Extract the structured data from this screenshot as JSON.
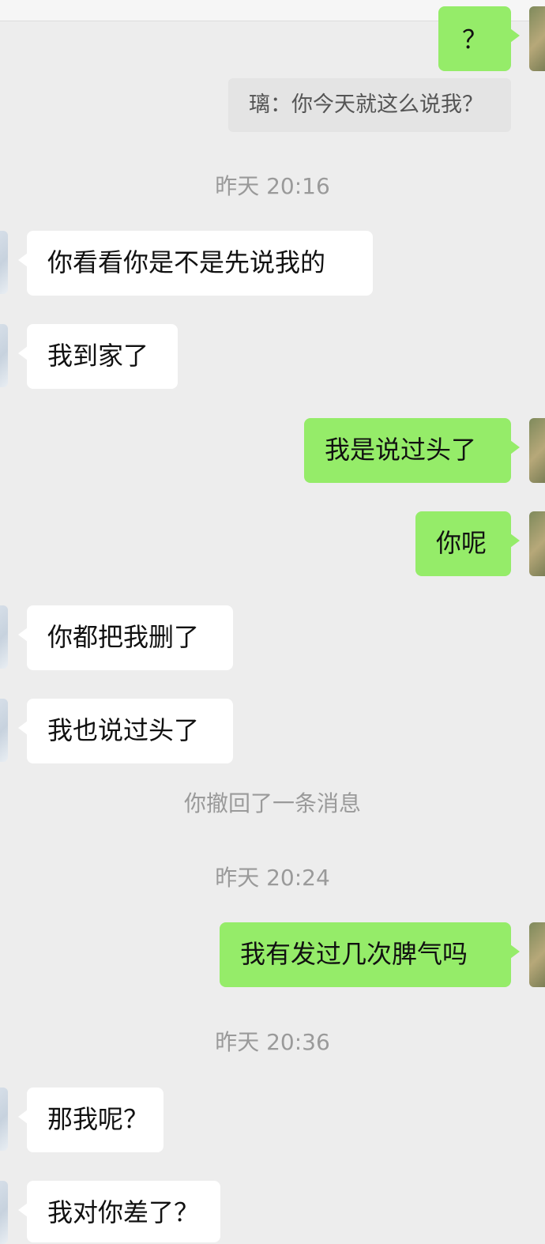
{
  "chat": {
    "messages": [
      {
        "side": "out",
        "text": "？"
      },
      {
        "side": "quote",
        "text": "璃：你今天就这么说我？"
      },
      {
        "type": "time",
        "text": "昨天 20:16"
      },
      {
        "side": "in",
        "text": "你看看你是不是先说我的"
      },
      {
        "side": "in",
        "text": "我到家了"
      },
      {
        "side": "out",
        "text": "我是说过头了"
      },
      {
        "side": "out",
        "text": "你呢"
      },
      {
        "side": "in",
        "text": "你都把我删了"
      },
      {
        "side": "in",
        "text": "我也说过头了"
      },
      {
        "type": "system",
        "text": "你撤回了一条消息"
      },
      {
        "type": "time",
        "text": "昨天 20:24"
      },
      {
        "side": "out",
        "text": "我有发过几次脾气吗"
      },
      {
        "type": "time",
        "text": "昨天 20:36"
      },
      {
        "side": "in",
        "text": "那我呢？"
      },
      {
        "side": "in",
        "text": "我对你差了？"
      }
    ]
  },
  "colors": {
    "background": "#ededed",
    "incoming_bubble": "#ffffff",
    "outgoing_bubble": "#95ec69",
    "meta_text": "#9a9a9a"
  }
}
